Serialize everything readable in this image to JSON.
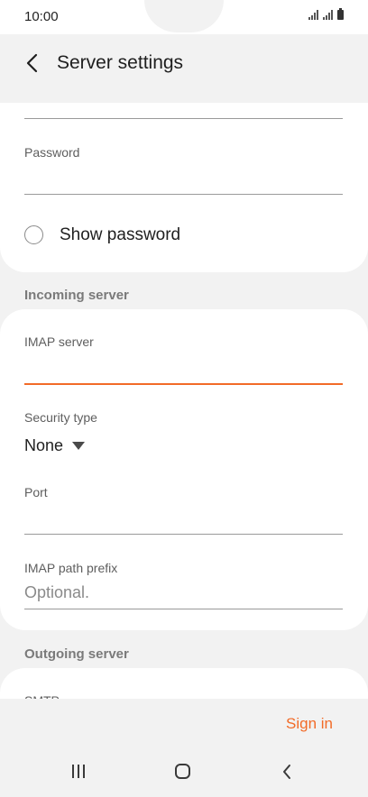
{
  "status": {
    "time": "10:00"
  },
  "header": {
    "title": "Server settings"
  },
  "account": {
    "password_label": "Password",
    "password_value": "",
    "show_password_label": "Show password",
    "show_password_checked": false
  },
  "incoming": {
    "section_title": "Incoming server",
    "imap_server_label": "IMAP server",
    "imap_server_value": "",
    "security_type_label": "Security type",
    "security_type_value": "None",
    "port_label": "Port",
    "port_value": "",
    "path_prefix_label": "IMAP path prefix",
    "path_prefix_placeholder": "Optional."
  },
  "outgoing": {
    "section_title": "Outgoing server",
    "smtp_label": "SMTP"
  },
  "actions": {
    "sign_in": "Sign in"
  },
  "colors": {
    "accent": "#f26b28",
    "background": "#f2f2f2",
    "card": "#ffffff"
  },
  "icons": {
    "back": "back-arrow-icon",
    "radio": "radio-unchecked-icon",
    "dropdown": "dropdown-triangle-icon",
    "nav_recent": "recent-apps-icon",
    "nav_home": "home-icon",
    "nav_back": "nav-back-icon"
  }
}
